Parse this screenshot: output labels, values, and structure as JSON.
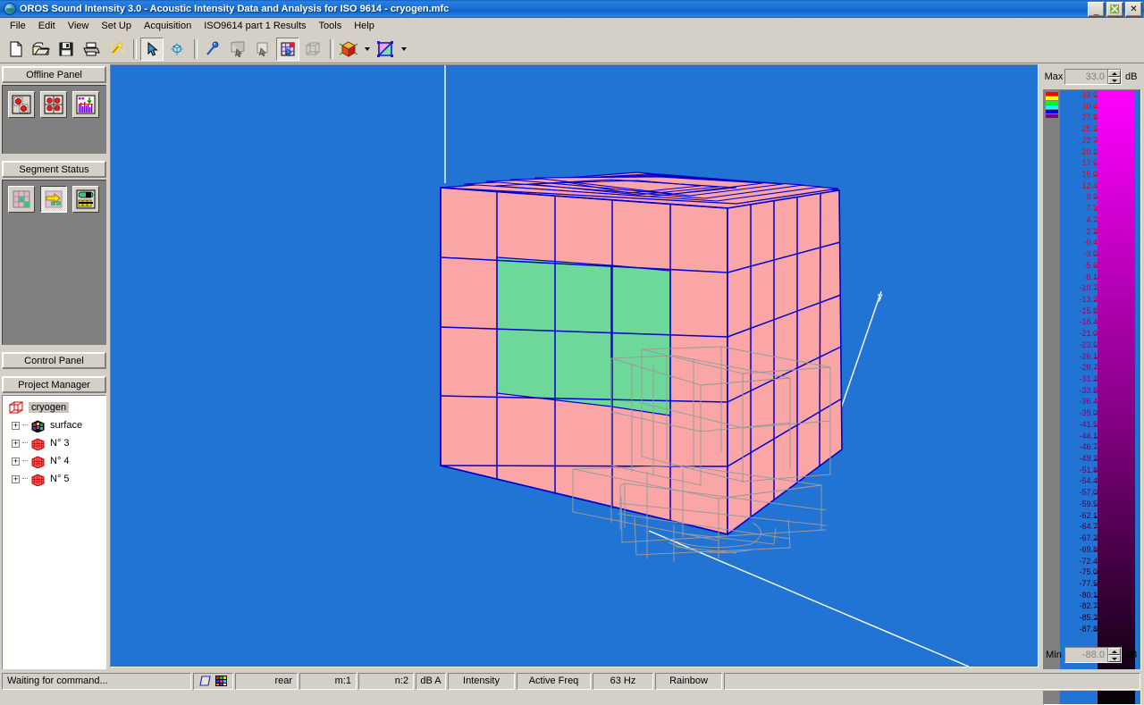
{
  "window": {
    "title": "OROS Sound Intensity 3.0 - Acoustic Intensity Data and Analysis for ISO 9614 - cryogen.mfc",
    "app_icon": "globe-icon",
    "buttons": {
      "minimize": "_",
      "restore": "❐",
      "close": "✕"
    }
  },
  "menu": {
    "items": [
      {
        "label": "File"
      },
      {
        "label": "Edit"
      },
      {
        "label": "View"
      },
      {
        "label": "Set Up"
      },
      {
        "label": "Acquisition"
      },
      {
        "label": "ISO9614 part 1 Results"
      },
      {
        "label": "Tools"
      },
      {
        "label": "Help"
      }
    ]
  },
  "toolbar": {
    "groups": [
      {
        "buttons": [
          {
            "name": "new-document-icon",
            "pressed": false
          },
          {
            "name": "open-folder-icon",
            "pressed": false
          },
          {
            "name": "save-floppy-icon",
            "pressed": false
          },
          {
            "name": "print-icon",
            "pressed": false
          },
          {
            "name": "magic-wand-icon",
            "pressed": false
          }
        ]
      },
      {
        "buttons": [
          {
            "name": "select-arrow-icon",
            "pressed": true
          },
          {
            "name": "rotate-object-icon",
            "pressed": false
          }
        ]
      },
      {
        "buttons": [
          {
            "name": "probe-pin-icon",
            "pressed": false
          },
          {
            "name": "copy-surface-icon",
            "pressed": false
          },
          {
            "name": "paste-surface-icon",
            "pressed": false
          },
          {
            "name": "mesh-grid-icon",
            "pressed": true
          },
          {
            "name": "wireframe-cube-icon",
            "pressed": false
          }
        ]
      },
      {
        "buttons": [
          {
            "name": "colored-cube-icon",
            "pressed": false,
            "dropdown": true
          },
          {
            "name": "shaded-triangle-icon",
            "pressed": false,
            "dropdown": true
          }
        ]
      }
    ]
  },
  "sidebar": {
    "offline_panel": {
      "title": "Offline Panel",
      "buttons": [
        {
          "name": "single-segment-view-icon",
          "selected": false
        },
        {
          "name": "quad-segment-view-icon",
          "selected": false
        },
        {
          "name": "spectrum-chart-icon",
          "selected": false
        }
      ]
    },
    "segment_status": {
      "title": "Segment Status",
      "buttons": [
        {
          "name": "segment-grid-icon",
          "selected": false
        },
        {
          "name": "segment-next-arrow-icon",
          "selected": true
        },
        {
          "name": "segment-table-icon",
          "selected": false
        }
      ]
    },
    "control_panel": {
      "title": "Control Panel"
    },
    "project_manager": {
      "title": "Project Manager",
      "tree": [
        {
          "label": "cryogen",
          "icon": "wireframe-cube-icon",
          "expandable": false,
          "selected": true,
          "indent": 0
        },
        {
          "label": "surface",
          "icon": "colored-mesh-cube-icon",
          "expandable": true,
          "selected": false,
          "indent": 1
        },
        {
          "label": "N° 3",
          "icon": "red-mesh-cube-icon",
          "expandable": true,
          "selected": false,
          "indent": 1
        },
        {
          "label": "N° 4",
          "icon": "red-mesh-cube-icon",
          "expandable": true,
          "selected": false,
          "indent": 1
        },
        {
          "label": "N° 5",
          "icon": "red-mesh-cube-icon",
          "expandable": true,
          "selected": false,
          "indent": 1
        }
      ]
    }
  },
  "viewport": {
    "background_color": "#2274d4",
    "axis_label_y": "y",
    "mesh": {
      "face_default_color": "#fba6a6",
      "face_highlight_color": "#6ed89b",
      "edge_color": "#0000cc",
      "wireframe_color": "#9a9a9a",
      "axis_color": "#ffffff",
      "columns": 5,
      "rows": 5,
      "highlighted_cells": "rows 2-4 / columns 2-3 of front face"
    }
  },
  "scale": {
    "max_label": "Max",
    "max_value": "33.0",
    "min_label": "Min",
    "min_value": "-88.0",
    "unit": "dB",
    "palette_name": "Rainbow",
    "legend_swatches": [
      "#ff0000",
      "#ffff00",
      "#00ff00",
      "#00ffff",
      "#0000ff",
      "#800080"
    ],
    "gradient_top_color": "#ff00ff",
    "gradient_mid_color": "#800080",
    "gradient_bottom_color": "#050005",
    "tick_labels": [
      "33.0",
      "30.4",
      "27.9",
      "25.3",
      "22.7",
      "20.1",
      "17.6",
      "15.0",
      "12.4",
      "9.9",
      "7.3",
      "4.7",
      "2.2",
      "-0.4",
      "-3.0",
      "-5.6",
      "-8.1",
      "-10.7",
      "-13.3",
      "-15.8",
      "-18.4",
      "-21.0",
      "-23.5",
      "-26.1",
      "-28.7",
      "-31.3",
      "-33.8",
      "-36.4",
      "-39.0",
      "-41.5",
      "-44.1",
      "-46.7",
      "-49.2",
      "-51.8",
      "-54.4",
      "-57.0",
      "-59.5",
      "-62.1",
      "-64.7",
      "-67.2",
      "-69.8",
      "-72.4",
      "-75.0",
      "-77.5",
      "-80.1",
      "-82.7",
      "-85.2",
      "-87.8"
    ]
  },
  "statusbar": {
    "message": "Waiting for command...",
    "icons": [
      {
        "name": "shape-tool-icon"
      },
      {
        "name": "color-palette-icon"
      }
    ],
    "cells": [
      {
        "name": "face-orientation",
        "value": "rear"
      },
      {
        "name": "mesh-row-index",
        "value": "m:1"
      },
      {
        "name": "mesh-column-index",
        "value": "n:2"
      },
      {
        "name": "weighting",
        "value": "dB A"
      },
      {
        "name": "quantity",
        "value": "Intensity"
      },
      {
        "name": "frequency-mode",
        "value": "Active Freq"
      },
      {
        "name": "frequency-value",
        "value": "63 Hz"
      },
      {
        "name": "color-palette",
        "value": "Rainbow"
      }
    ]
  }
}
